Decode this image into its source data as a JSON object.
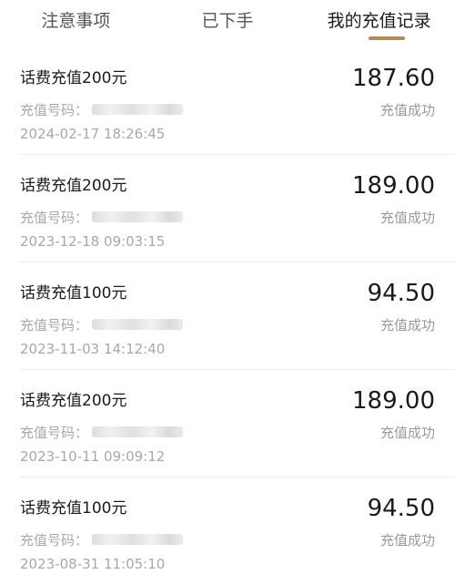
{
  "tabs": [
    {
      "label": "注意事项",
      "active": false
    },
    {
      "label": "已下手",
      "active": false
    },
    {
      "label": "我的充值记录",
      "active": true
    }
  ],
  "accent_color": "#b08d55",
  "records": [
    {
      "title": "话费充值200元",
      "amount": "187.60",
      "phone_label": "充值号码：",
      "status": "充值成功",
      "time": "2024-02-17 18:26:45"
    },
    {
      "title": "话费充值200元",
      "amount": "189.00",
      "phone_label": "充值号码：",
      "status": "充值成功",
      "time": "2023-12-18 09:03:15"
    },
    {
      "title": "话费充值100元",
      "amount": "94.50",
      "phone_label": "充值号码：",
      "status": "充值成功",
      "time": "2023-11-03 14:12:40"
    },
    {
      "title": "话费充值200元",
      "amount": "189.00",
      "phone_label": "充值号码：",
      "status": "充值成功",
      "time": "2023-10-11 09:09:12"
    },
    {
      "title": "话费充值100元",
      "amount": "94.50",
      "phone_label": "充值号码：",
      "status": "充值成功",
      "time": "2023-08-31 11:05:10"
    }
  ]
}
